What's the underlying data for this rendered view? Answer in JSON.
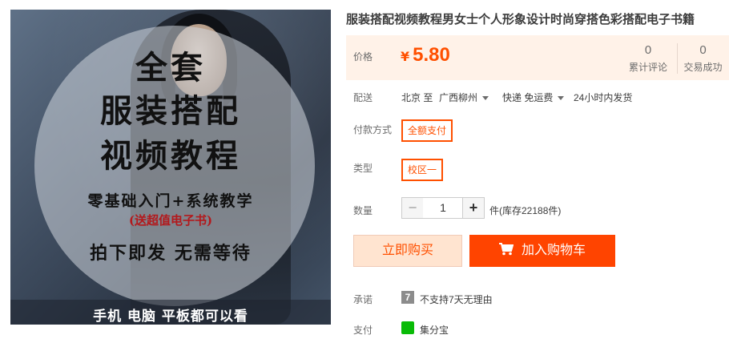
{
  "product": {
    "title": "服装搭配视频教程男女士个人形象设计时尚穿搭色彩搭配电子书籍",
    "image_text": {
      "line1": "全套",
      "line2": "服装搭配",
      "line3": "视频教程",
      "subtitle": "零基础入门+系统教学",
      "bonus": "(送超值电子书)",
      "line4": "拍下即发 无需等待",
      "bottom": "手机 电脑 平板都可以看"
    }
  },
  "price": {
    "label": "价格",
    "currency": "¥",
    "amount": "5.80",
    "comments_count": "0",
    "comments_label": "累计评论",
    "sales_count": "0",
    "sales_label": "交易成功"
  },
  "delivery": {
    "label": "配送",
    "from": "北京 至",
    "to": "广西柳州",
    "shipping": "快递 免运费",
    "dispatch": "24小时内发货"
  },
  "payment": {
    "label": "付款方式",
    "option": "全额支付"
  },
  "type": {
    "label": "类型",
    "option": "校区一"
  },
  "quantity": {
    "label": "数量",
    "minus": "−",
    "value": "1",
    "plus": "+",
    "stock": "件(库存22188件)"
  },
  "actions": {
    "buy_now": "立即购买",
    "add_to_cart": "加入购物车"
  },
  "promise": {
    "label": "承诺",
    "icon_text": "7",
    "text": "不支持7天无理由"
  },
  "pay_row": {
    "label": "支付",
    "text": "集分宝"
  },
  "colors": {
    "accent": "#ff5000",
    "cart_button": "#ff4400",
    "price_panel_bg": "#fff2e8",
    "buy_button_bg": "#ffe4d0"
  },
  "icons": {
    "cart": "shopping-cart-icon",
    "caret": "chevron-down-icon",
    "seven_day": "seven-day-icon",
    "payment": "jifenbao-icon"
  }
}
